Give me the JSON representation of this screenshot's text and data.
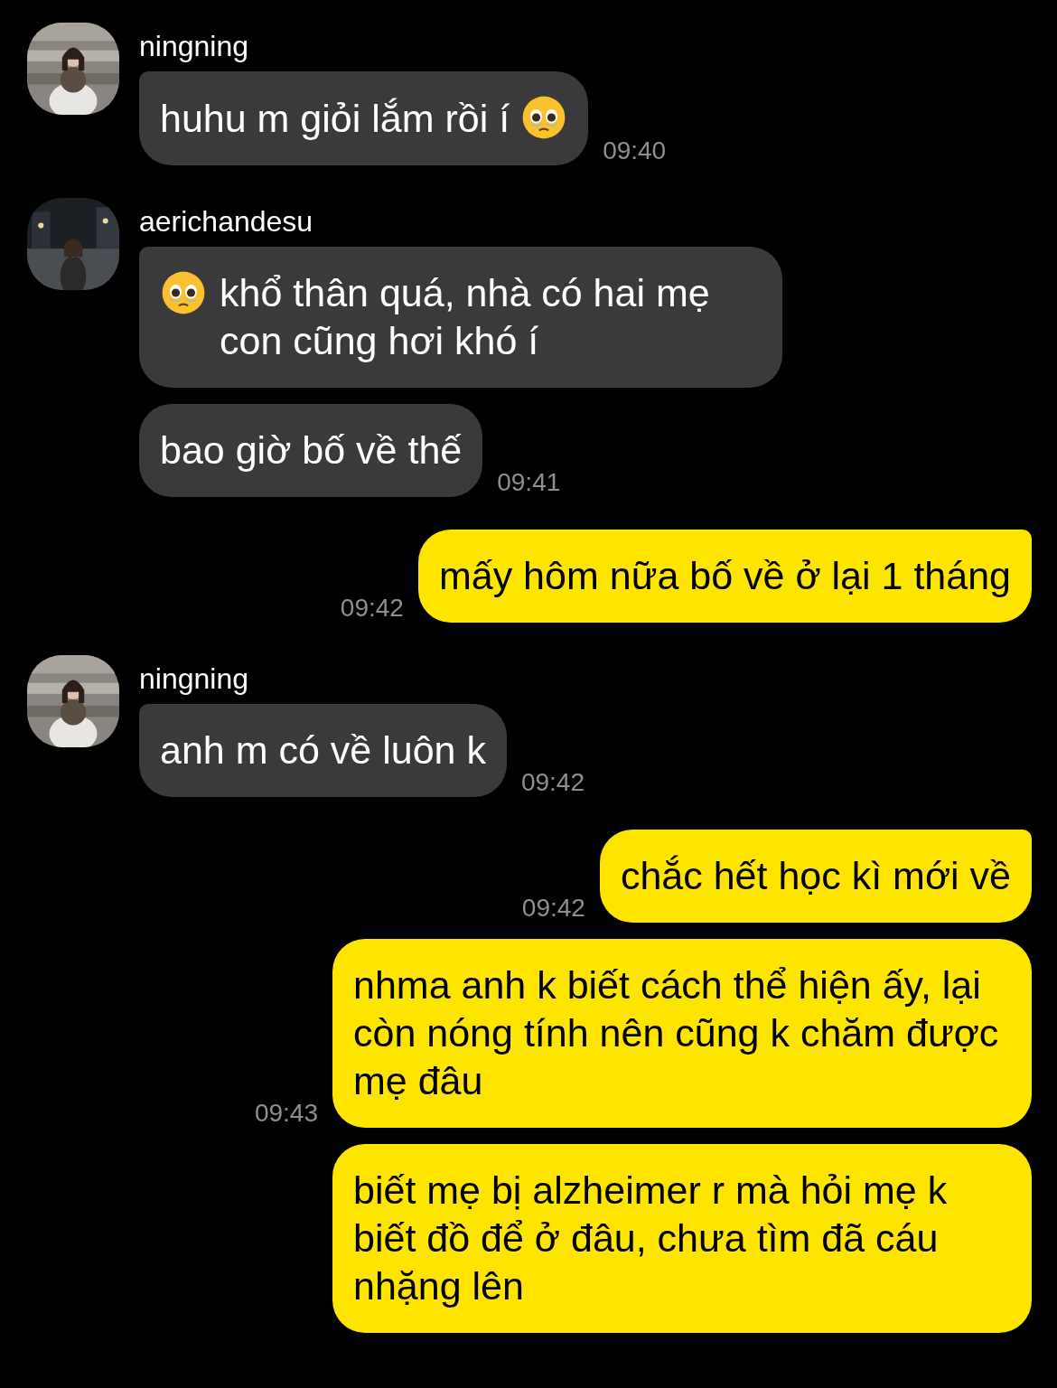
{
  "groups": [
    {
      "kind": "incoming",
      "sender": "ningning",
      "messages": [
        {
          "text": "huhu m giỏi lắm rồi í",
          "trailing_emoji": true,
          "time": "09:40"
        }
      ]
    },
    {
      "kind": "incoming",
      "sender": "aerichandesu",
      "messages": [
        {
          "text": "khổ thân quá, nhà có hai mẹ con cũng hơi khó í",
          "leading_emoji": true
        },
        {
          "text": "bao giờ bố về thế",
          "time": "09:41"
        }
      ]
    },
    {
      "kind": "outgoing",
      "messages": [
        {
          "text": "mấy hôm nữa bố về ở lại 1 tháng",
          "time": "09:42"
        }
      ]
    },
    {
      "kind": "incoming",
      "sender": "ningning",
      "messages": [
        {
          "text": "anh m có về luôn k",
          "time": "09:42"
        }
      ]
    },
    {
      "kind": "outgoing",
      "messages": [
        {
          "text": "chắc hết học kì mới về",
          "time": "09:42"
        },
        {
          "text": "nhma anh k biết cách thể hiện ấy, lại còn nóng tính nên cũng k chăm được mẹ đâu",
          "time": "09:43"
        },
        {
          "text": "biết mẹ bị alzheimer r mà hỏi mẹ k biết đồ để ở đâu, chưa tìm đã cáu nhặng lên"
        }
      ]
    }
  ]
}
